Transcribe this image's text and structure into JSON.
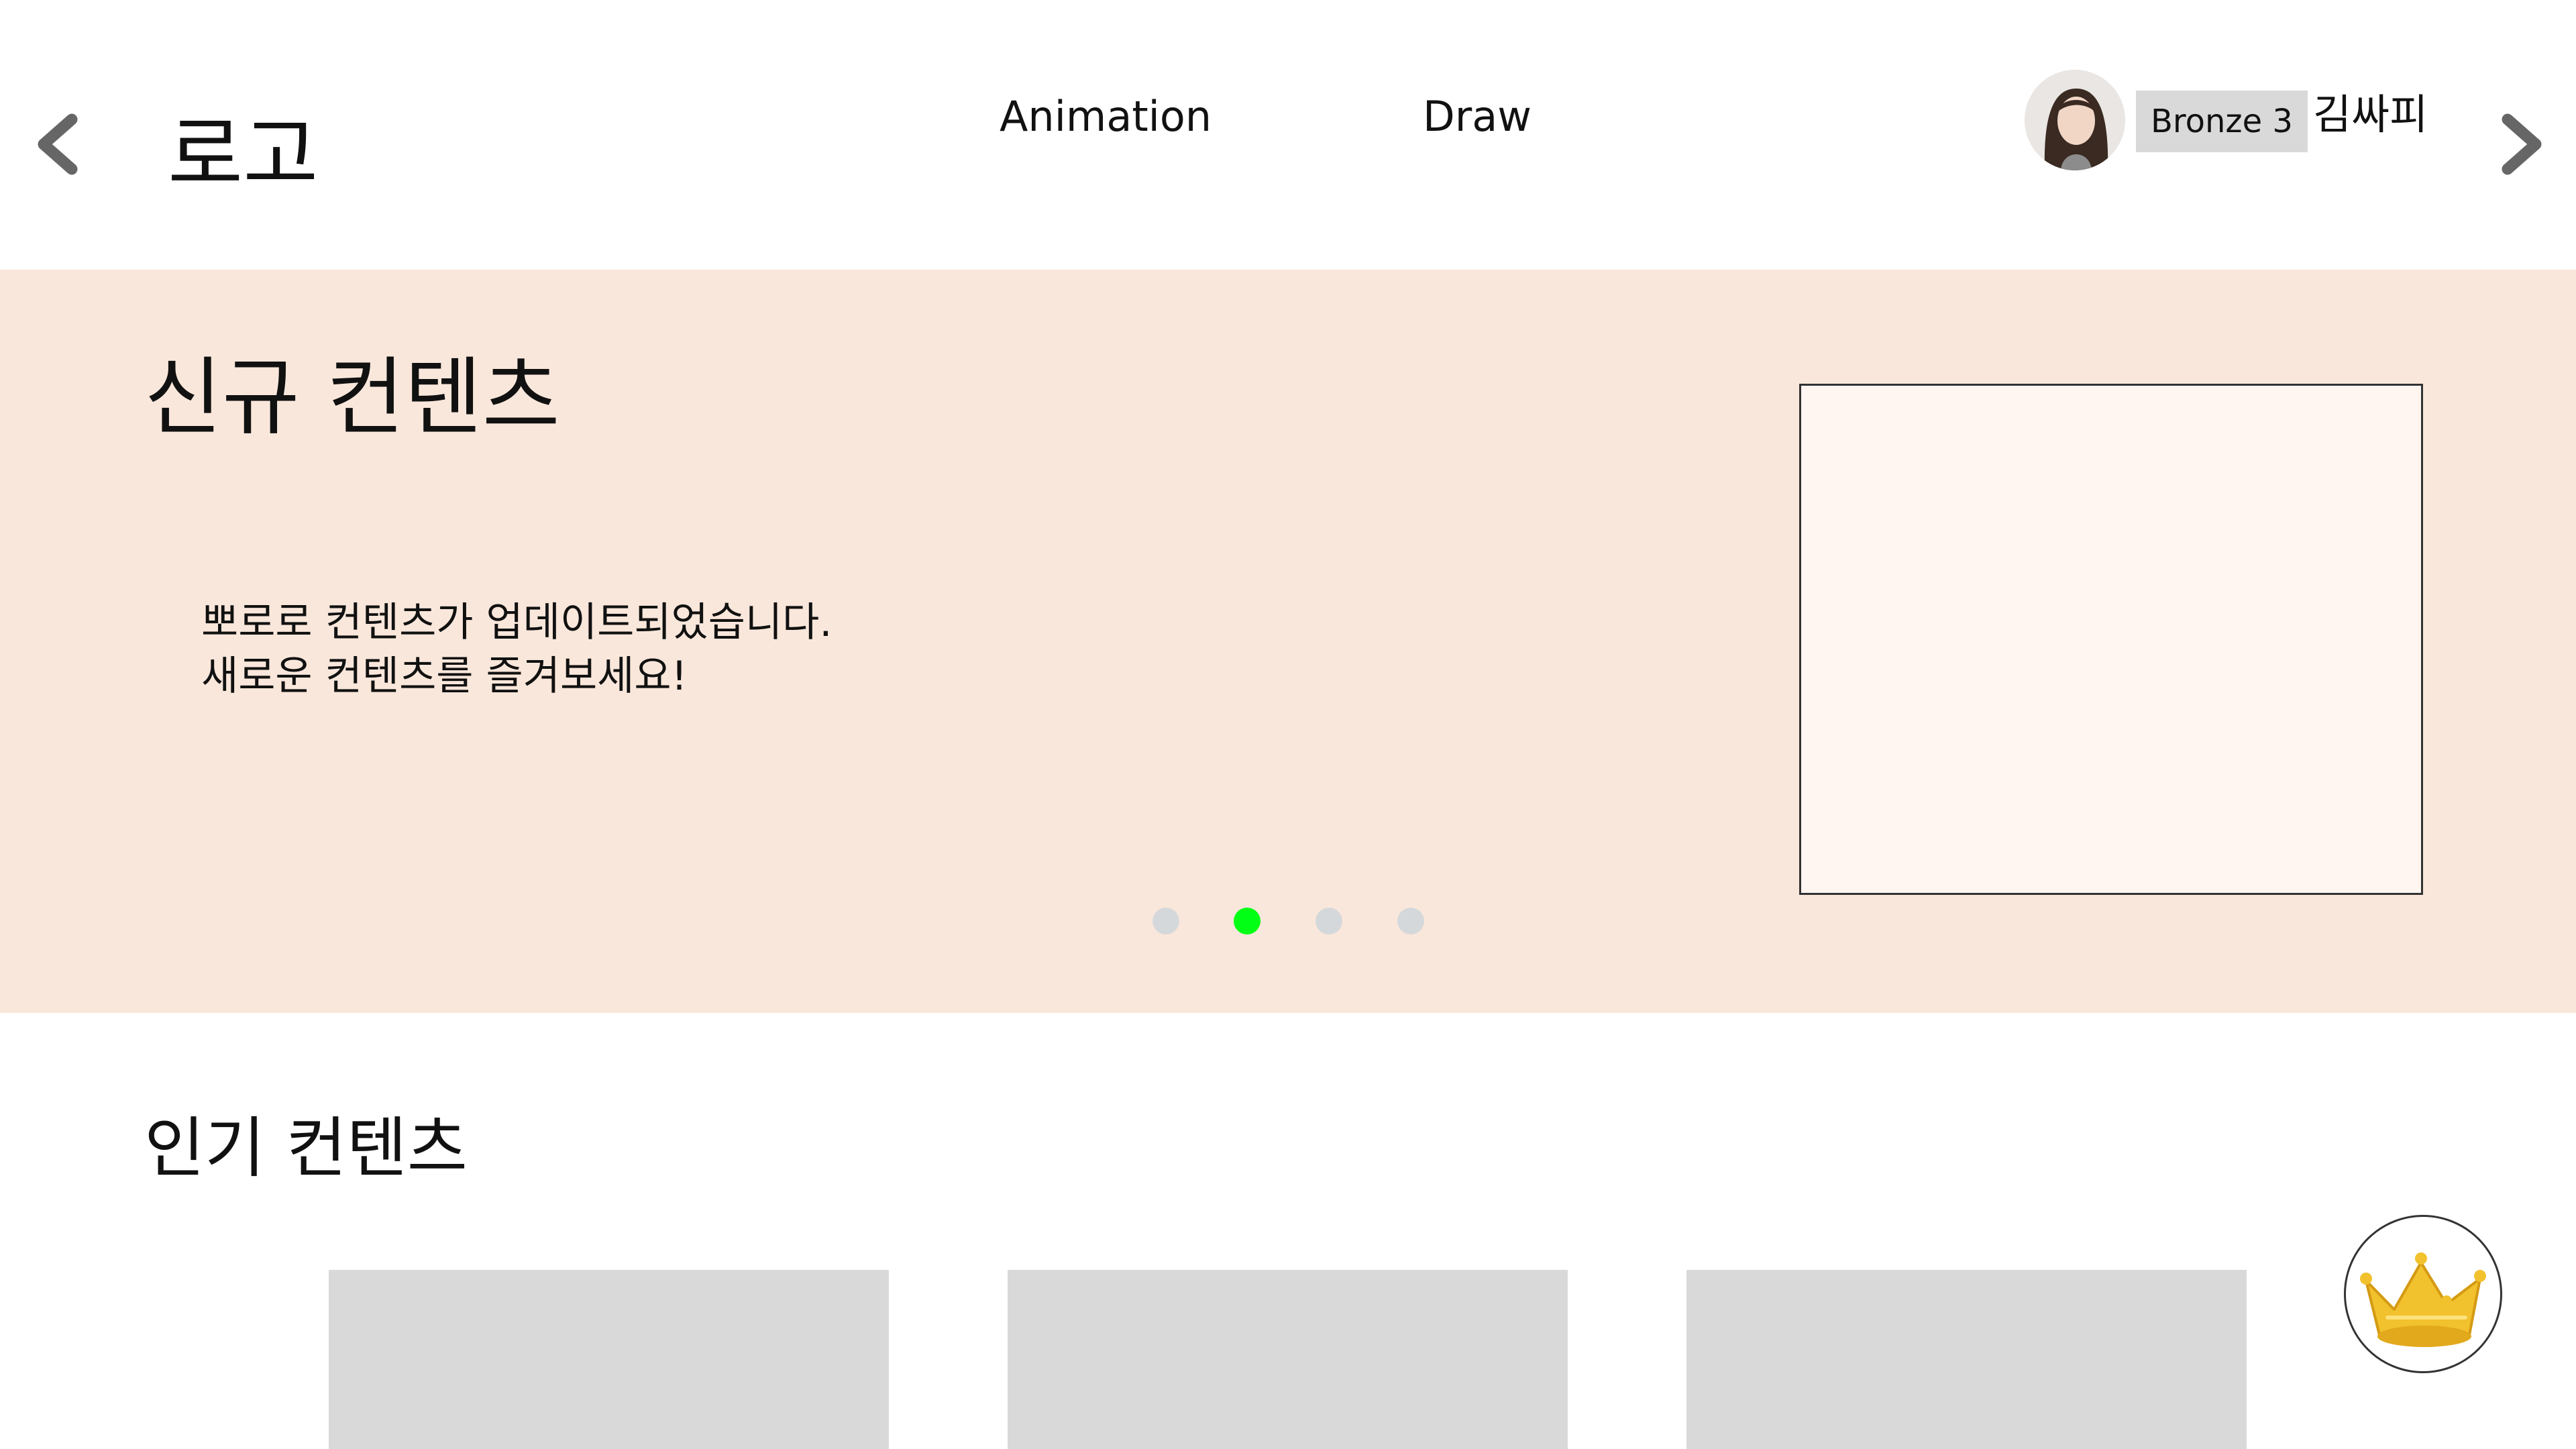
{
  "header": {
    "logo": "로고",
    "menu": [
      {
        "label": "Animation"
      },
      {
        "label": "Draw"
      }
    ],
    "user": {
      "rank": "Bronze 3",
      "name": "김싸피"
    },
    "icons": {
      "back": "chevron-left-icon",
      "forward": "chevron-right-icon",
      "avatar": "profile-photo"
    }
  },
  "banner": {
    "title": "신규 컨텐츠",
    "lines": [
      "뽀로로 컨텐츠가 업데이트되었습니다.",
      "새로운 컨텐츠를 즐겨보세요!"
    ],
    "slides_count": 4,
    "active_slide": 2,
    "colors": {
      "background": "#fae7db",
      "active_dot": "#00ff14",
      "inactive_dot": "#d5d8db"
    }
  },
  "popular": {
    "title": "인기 컨텐츠",
    "cards": [
      {},
      {},
      {}
    ]
  },
  "floating": {
    "icon": "crown-icon"
  }
}
